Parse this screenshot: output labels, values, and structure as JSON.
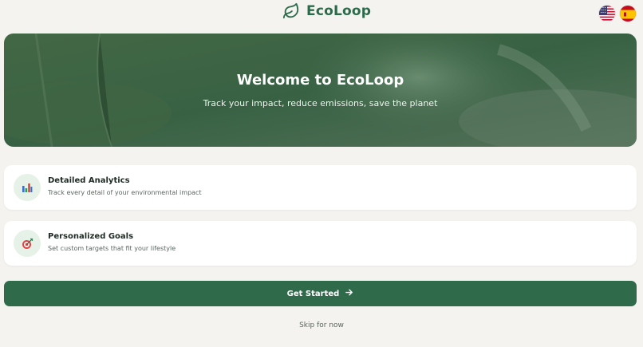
{
  "brand": {
    "name": "EcoLoop",
    "logo_icon": "leaf-icon",
    "color": "#2d6a4a"
  },
  "languages": [
    {
      "code": "en-US",
      "icon": "us-flag-icon"
    },
    {
      "code": "es",
      "icon": "spain-flag-icon"
    }
  ],
  "hero": {
    "title": "Welcome to EcoLoop",
    "subtitle": "Track your impact, reduce emissions, save the planet"
  },
  "features": [
    {
      "title": "Detailed Analytics",
      "description": "Track every detail of your environmental impact",
      "icon": "bar-chart-icon"
    },
    {
      "title": "Personalized Goals",
      "description": "Set custom targets that fit your lifestyle",
      "icon": "target-icon"
    }
  ],
  "actions": {
    "get_started": "Get Started",
    "get_started_icon": "arrow-right-icon",
    "skip": "Skip for now"
  },
  "colors": {
    "primary": "#2f6b4b",
    "background": "#f4f3ef",
    "icon_bg": "#e6f1e8"
  }
}
